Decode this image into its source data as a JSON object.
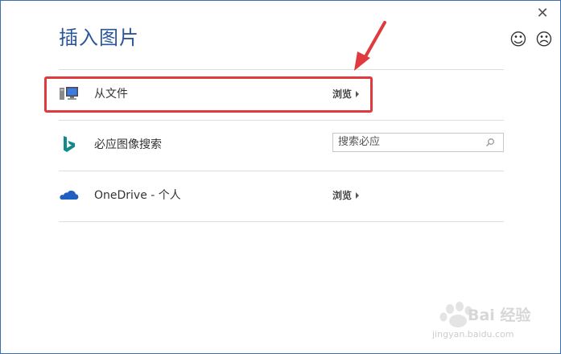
{
  "dialog": {
    "title": "插入图片",
    "close_glyph": "✕",
    "feedback": {
      "smile_glyph": "☺",
      "frown_glyph": "☹"
    }
  },
  "rows": [
    {
      "label": "从文件",
      "icon": "computer-icon",
      "action_label": "浏览"
    },
    {
      "label": "必应图像搜索",
      "icon": "bing-icon",
      "search_placeholder": "搜索必应",
      "search_icon": "search-icon"
    },
    {
      "label": "OneDrive - 个人",
      "icon": "onedrive-cloud-icon",
      "action_label": "浏览"
    }
  ],
  "annotation": {
    "color": "#e0393e"
  },
  "watermark": {
    "brand": "Bai 经验",
    "url": "jingyan.baidu.com"
  },
  "colors": {
    "title": "#2b579a",
    "border": "#3a6fb0",
    "bing": "#138a8a",
    "onedrive": "#1f5fbf"
  }
}
